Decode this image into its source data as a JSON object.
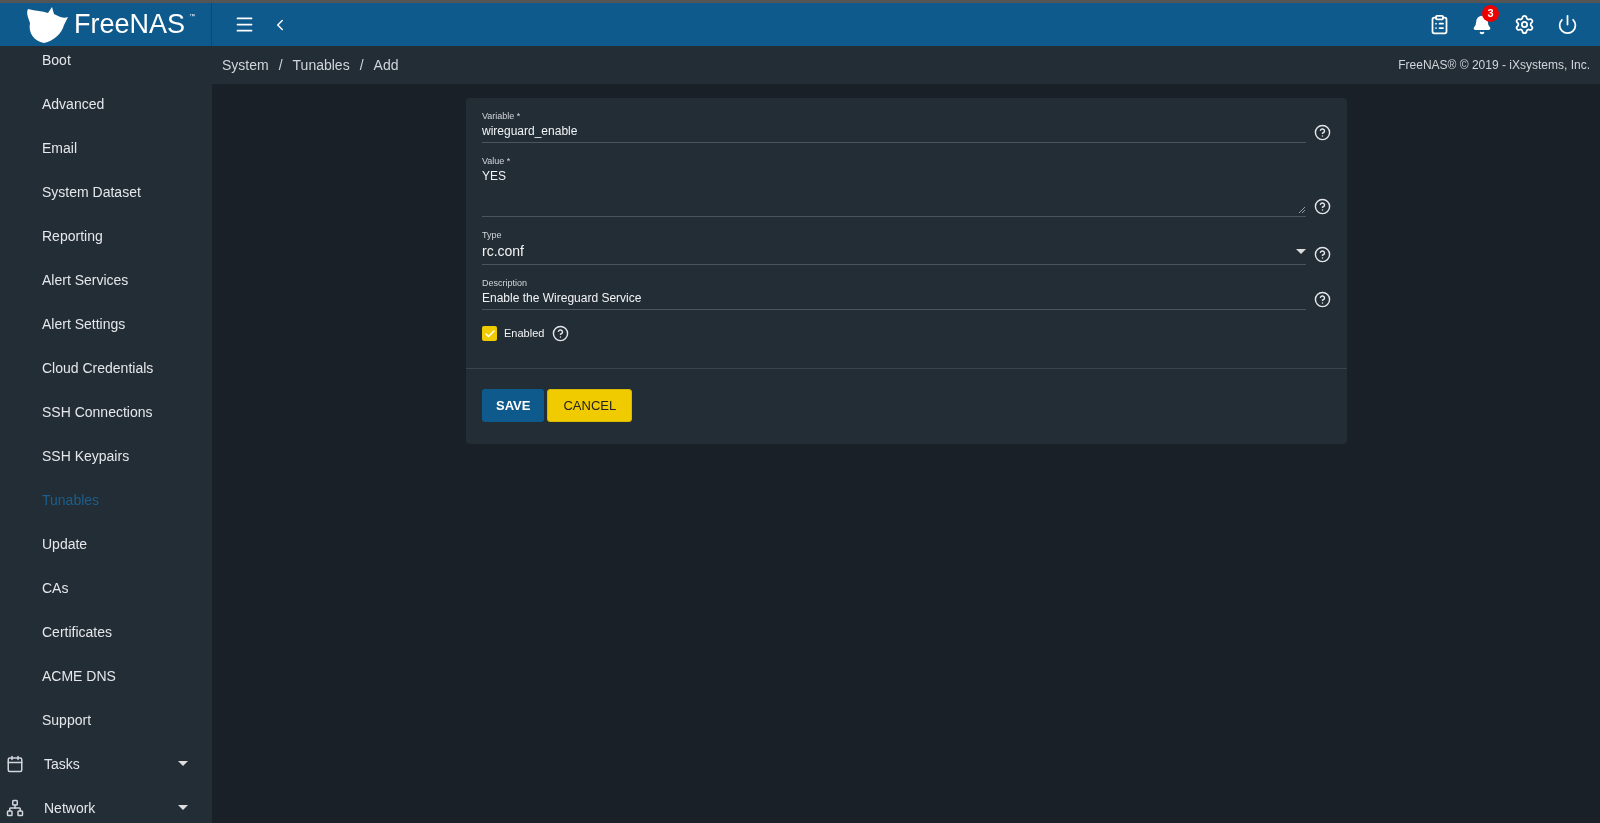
{
  "header": {
    "logo_text": "FreeNAS",
    "logo_mark": "™",
    "notification_count": "3"
  },
  "sidebar": {
    "items": [
      {
        "label": "Boot",
        "kind": "link",
        "selected": false
      },
      {
        "label": "Advanced",
        "kind": "link",
        "selected": false
      },
      {
        "label": "Email",
        "kind": "link",
        "selected": false
      },
      {
        "label": "System Dataset",
        "kind": "link",
        "selected": false
      },
      {
        "label": "Reporting",
        "kind": "link",
        "selected": false
      },
      {
        "label": "Alert Services",
        "kind": "link",
        "selected": false
      },
      {
        "label": "Alert Settings",
        "kind": "link",
        "selected": false
      },
      {
        "label": "Cloud Credentials",
        "kind": "link",
        "selected": false
      },
      {
        "label": "SSH Connections",
        "kind": "link",
        "selected": false
      },
      {
        "label": "SSH Keypairs",
        "kind": "link",
        "selected": false
      },
      {
        "label": "Tunables",
        "kind": "link",
        "selected": true
      },
      {
        "label": "Update",
        "kind": "link",
        "selected": false
      },
      {
        "label": "CAs",
        "kind": "link",
        "selected": false
      },
      {
        "label": "Certificates",
        "kind": "link",
        "selected": false
      },
      {
        "label": "ACME DNS",
        "kind": "link",
        "selected": false
      },
      {
        "label": "Support",
        "kind": "link",
        "selected": false
      },
      {
        "label": "Tasks",
        "kind": "calendar-group",
        "selected": false
      },
      {
        "label": "Network",
        "kind": "network-group",
        "selected": false
      }
    ]
  },
  "breadcrumb": {
    "separator": "/",
    "items": [
      "System",
      "Tunables",
      "Add"
    ]
  },
  "copyright": "FreeNAS® © 2019 - iXsystems, Inc.",
  "form": {
    "fields": [
      {
        "kind": "text",
        "label": "Variable *",
        "value": "wireguard_enable"
      },
      {
        "kind": "textarea",
        "label": "Value *",
        "value": "YES"
      },
      {
        "kind": "select",
        "label": "Type",
        "value": "rc.conf"
      },
      {
        "kind": "text",
        "label": "Description",
        "value": "Enable the Wireguard Service"
      }
    ],
    "checkbox": {
      "label": "Enabled",
      "checked": true
    },
    "buttons": [
      {
        "label": "SAVE",
        "kind": "primary"
      },
      {
        "label": "CANCEL",
        "kind": "secondary"
      }
    ]
  }
}
